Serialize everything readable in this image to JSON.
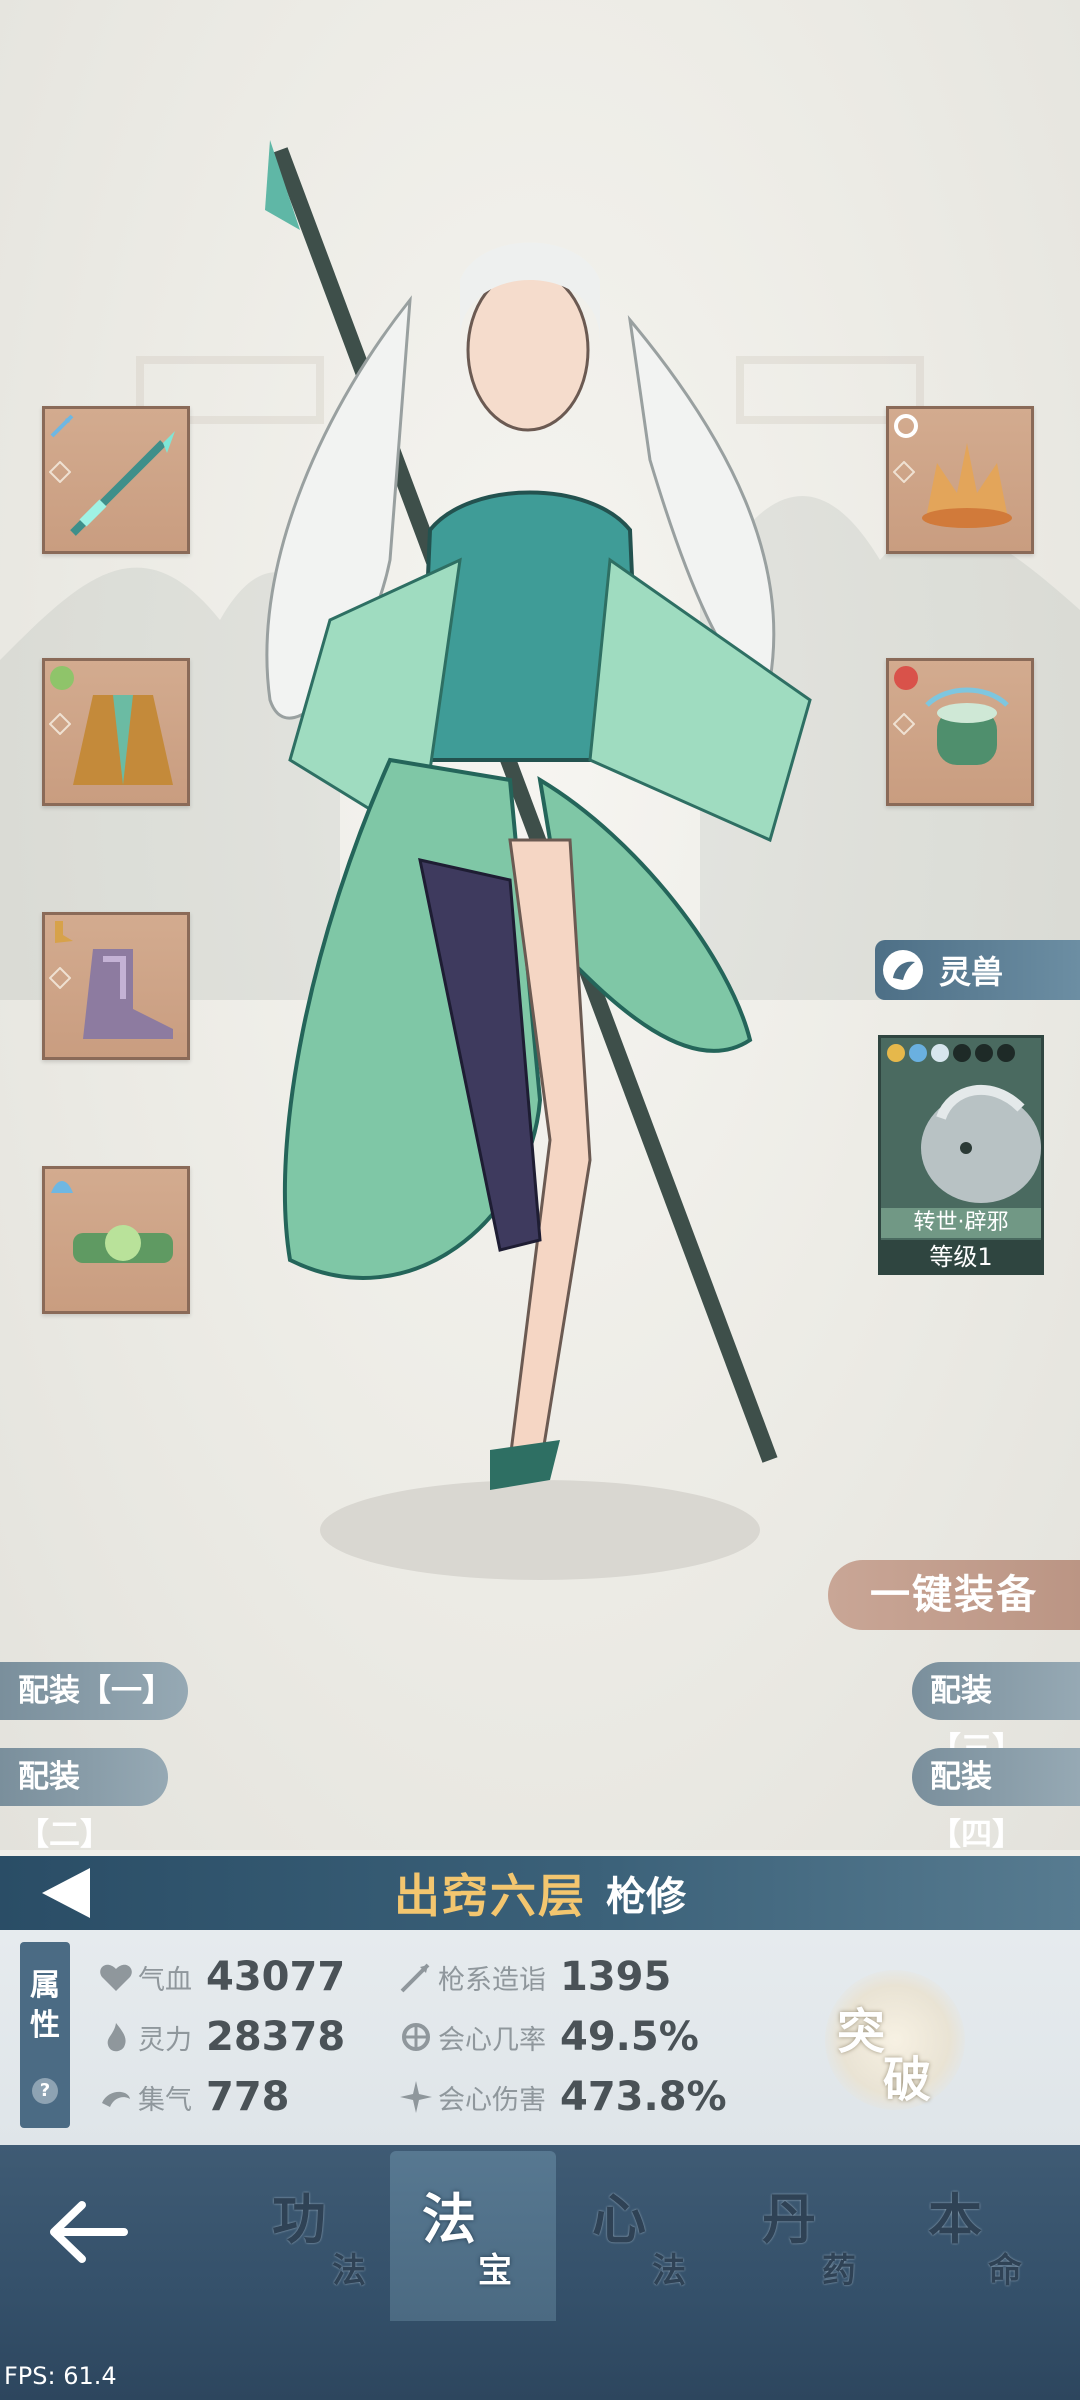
{
  "equipment": {
    "left": [
      {
        "name": "spear",
        "icon": "spear-icon"
      },
      {
        "name": "robe",
        "icon": "robe-icon"
      },
      {
        "name": "boots",
        "icon": "boots-icon"
      },
      {
        "name": "belt",
        "icon": "belt-icon"
      }
    ],
    "right": [
      {
        "name": "crown",
        "icon": "crown-icon"
      },
      {
        "name": "drum",
        "icon": "drum-icon"
      }
    ]
  },
  "pet": {
    "tab_label": "灵兽",
    "name": "转世·辟邪",
    "level": "等级1",
    "stars_filled": 3,
    "stars_total": 6
  },
  "buttons": {
    "equip_all": "一键装备",
    "loadout_1": "配装【一】",
    "loadout_2": "配装【二】",
    "loadout_3": "配装【三】",
    "loadout_4": "配装【四】"
  },
  "header": {
    "realm": "出窍六层",
    "class": "枪修"
  },
  "attributes": {
    "tab_label_1": "属",
    "tab_label_2": "性",
    "help": "?",
    "hp_label": "气血",
    "hp_value": "43077",
    "mp_label": "灵力",
    "mp_value": "28378",
    "qi_label": "集气",
    "qi_value": "778",
    "spear_label": "枪系造诣",
    "spear_value": "1395",
    "crit_rate_label": "会心几率",
    "crit_rate_value": "49.5%",
    "crit_dmg_label": "会心伤害",
    "crit_dmg_value": "473.8%",
    "breakthrough_1": "突",
    "breakthrough_2": "破"
  },
  "nav": [
    {
      "big": "功",
      "small": "法"
    },
    {
      "big": "法",
      "small": "宝"
    },
    {
      "big": "心",
      "small": "法"
    },
    {
      "big": "丹",
      "small": "药"
    },
    {
      "big": "本",
      "small": "命"
    }
  ],
  "fps": "FPS: 61.4",
  "colors": {
    "slot_bg": "#cfa68a",
    "header_gold": "#f3c66f",
    "navbar": "#3a5670"
  }
}
